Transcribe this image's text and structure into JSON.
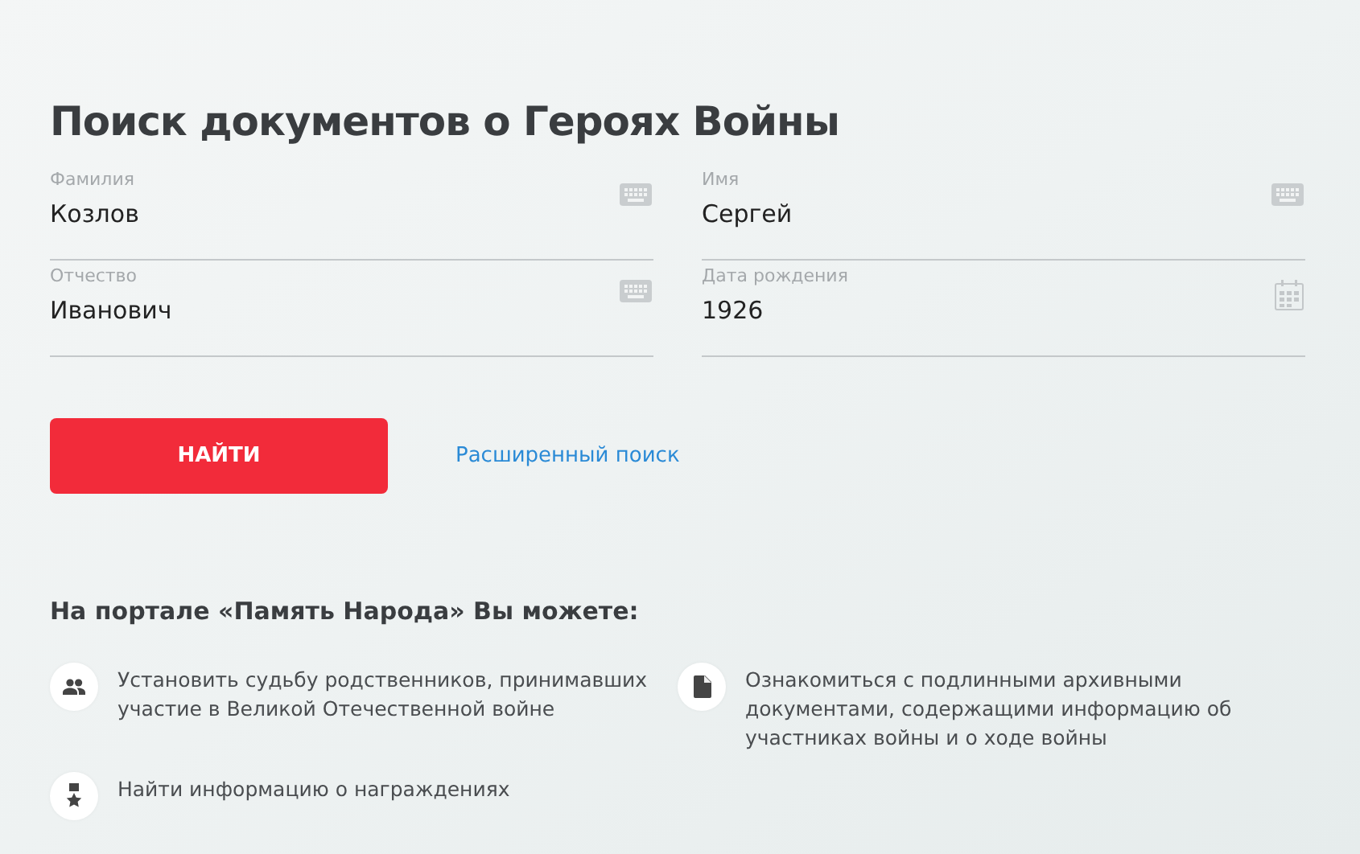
{
  "title": "Поиск документов о Героях Войны",
  "fields": [
    {
      "label": "Фамилия",
      "value": "Козлов",
      "kind": "text"
    },
    {
      "label": "Имя",
      "value": "Сергей",
      "kind": "text"
    },
    {
      "label": "Отчество",
      "value": "Иванович",
      "kind": "text"
    },
    {
      "label": "Дата рождения",
      "value": "1926",
      "kind": "date"
    }
  ],
  "search_button": "НАЙТИ",
  "advanced_link": "Расширенный поиск",
  "features_title": "На портале «Память Народа» Вы можете:",
  "features": [
    {
      "kind": "people",
      "text": "Установить судьбу родственников, принимавших участие в Великой Отечественной войне"
    },
    {
      "kind": "document",
      "text": "Ознакомиться с подлинными архивными документами, содержащими информацию об участниках войны и о ходе войны"
    },
    {
      "kind": "award",
      "text": "Найти информацию о награждениях"
    }
  ]
}
